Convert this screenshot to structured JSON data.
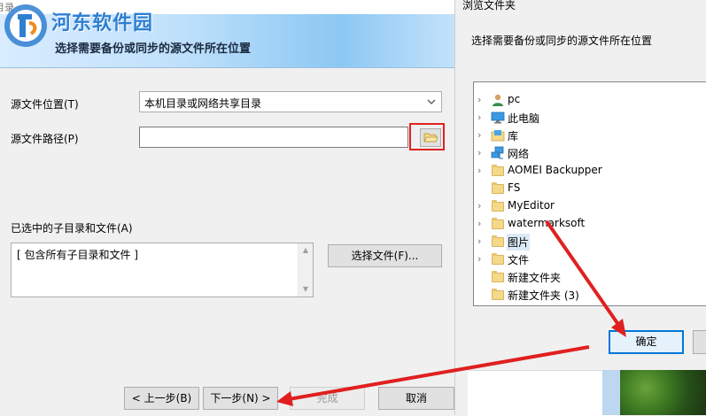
{
  "wizard": {
    "titlebar_fragment": "目录",
    "watermark": "河东软件园",
    "heading": "选择需要备份或同步的源文件所在位置",
    "source_location_label": "源文件位置(T)",
    "source_location_value": "本机目录或网络共享目录",
    "source_path_label": "源文件路径(P)",
    "source_path_value": "",
    "selected_label": "已选中的子目录和文件(A)",
    "selected_items": [
      "[ 包含所有子目录和文件 ]"
    ],
    "choose_files_button": "选择文件(F)...",
    "back_button": "< 上一步(B)",
    "next_button": "下一步(N) >",
    "finish_button": "完成",
    "cancel_button": "取消"
  },
  "browse_dialog": {
    "title": "浏览文件夹",
    "description": "选择需要备份或同步的源文件所在位置",
    "tree": [
      {
        "label": "pc",
        "icon": "user-icon",
        "expandable": true
      },
      {
        "label": "此电脑",
        "icon": "computer-icon",
        "expandable": true
      },
      {
        "label": "库",
        "icon": "library-icon",
        "expandable": true
      },
      {
        "label": "网络",
        "icon": "network-icon",
        "expandable": true
      },
      {
        "label": "AOMEI Backupper",
        "icon": "folder-icon",
        "expandable": true
      },
      {
        "label": "FS",
        "icon": "folder-icon",
        "expandable": false
      },
      {
        "label": "MyEditor",
        "icon": "folder-icon",
        "expandable": true
      },
      {
        "label": "watermarksoft",
        "icon": "folder-icon",
        "expandable": true
      },
      {
        "label": "图片",
        "icon": "folder-icon",
        "expandable": true,
        "selected": true
      },
      {
        "label": "文件",
        "icon": "folder-icon",
        "expandable": true
      },
      {
        "label": "新建文件夹",
        "icon": "folder-icon",
        "expandable": false
      },
      {
        "label": "新建文件夹 (3)",
        "icon": "folder-icon",
        "expandable": false
      }
    ],
    "ok_button": "确定"
  },
  "colors": {
    "highlight_red": "#e02020",
    "annotation_arrow": "#e02020",
    "ok_border": "#0078d7",
    "selection": "#dbe9f7"
  }
}
